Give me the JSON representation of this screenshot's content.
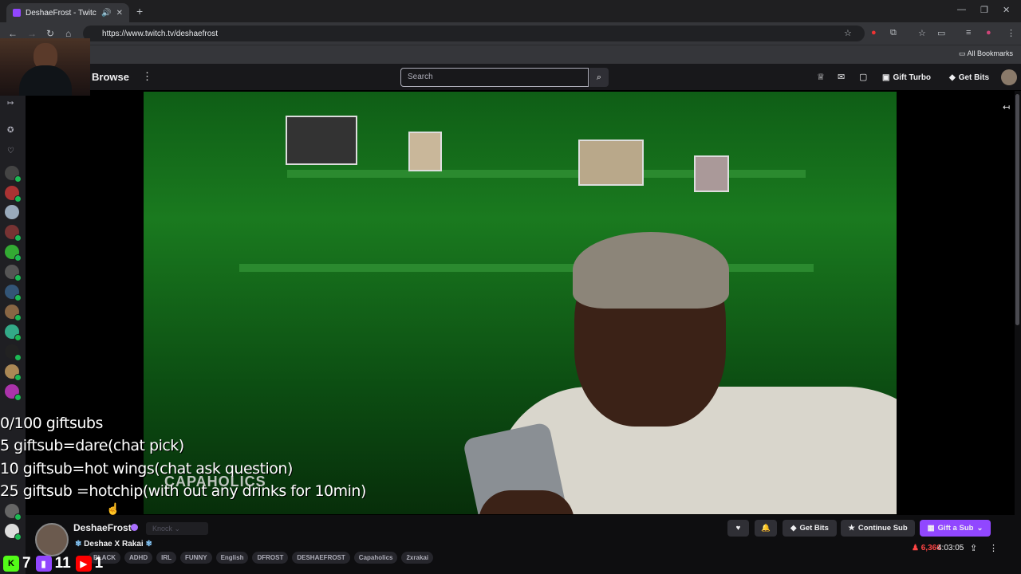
{
  "browser": {
    "tab_title": "DeshaeFrost - Twitch",
    "url": "https://www.twitch.tv/deshaefrost",
    "all_bookmarks": "All Bookmarks"
  },
  "twitch_nav": {
    "browse": "Browse",
    "search_placeholder": "Search",
    "gift_turbo": "Gift Turbo",
    "get_bits": "Get Bits"
  },
  "overlay": {
    "lines": [
      "0/100 giftsubs",
      "5 giftsub=dare(chat pick)",
      "10 giftsub=hot wings(chat ask question)",
      "25 giftsub =hotchip(with out any drinks for 10min)"
    ],
    "watermark": "CAPAHOLICS"
  },
  "channel": {
    "name": "DeshaeFrost",
    "knock": "Knock",
    "stream_title": "Deshae X Rakai",
    "tags": [
      "BLACK",
      "ADHD",
      "IRL",
      "FUNNY",
      "English",
      "DFROST",
      "DESHAEFROST",
      "Capaholics",
      "2xrakai"
    ],
    "get_bits": "Get Bits",
    "continue_sub": "Continue Sub",
    "gift_a_sub": "Gift a Sub",
    "viewers": "6,366",
    "uptime": "4:03:05"
  },
  "socials": [
    {
      "platform": "kick",
      "count": "7"
    },
    {
      "platform": "twitch",
      "count": "11"
    },
    {
      "platform": "youtube",
      "count": "1"
    }
  ],
  "colors": {
    "twitch_purple": "#9147ff",
    "kick_green": "#53fc18",
    "youtube_red": "#ff0000"
  }
}
